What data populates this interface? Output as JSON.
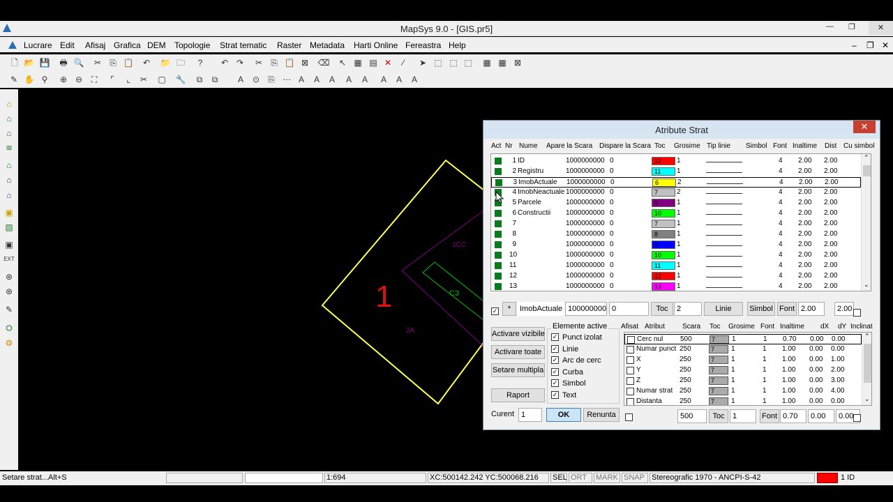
{
  "app": {
    "title": "MapSys 9.0 - [GIS.pr5]",
    "min": "—",
    "restore": "❐",
    "close": "✕"
  },
  "menu": [
    "Lucrare",
    "Edit",
    "Afisaj",
    "Grafica",
    "DEM",
    "Topologie",
    "Strat tematic",
    "Raster",
    "Metadata",
    "Harti Online",
    "Fereastra",
    "Help"
  ],
  "canvas": {
    "label_big": "1",
    "label_1cc": "1CC",
    "label_c3": "C3",
    "label_2a": "2A"
  },
  "status": {
    "hint": "Setare strat...Alt+S",
    "scale": "1:694",
    "coords": "XC:500142.242 YC:500068.216",
    "sel": "SEL",
    "ort": "ORT",
    "mark": "MARK",
    "snap": "SNAP",
    "proj": "Stereografic 1970 - ANCPI-S-42",
    "layer": "1 ID",
    "layer_color": "#ff0000"
  },
  "dialog": {
    "title": "Atribute Strat",
    "headers": {
      "act": "Act",
      "nr": "Nr",
      "nume": "Nume",
      "apare": "Apare la Scara",
      "dispare": "Dispare la Scara",
      "toc": "Toc",
      "grosime": "Grosime",
      "tip": "Tip linie",
      "simbol": "Simbol",
      "font": "Font",
      "inaltime": "Inaltime",
      "dist": "Dist",
      "cusimbol": "Cu simbol"
    },
    "rows": [
      {
        "nr": "1",
        "nume": "ID",
        "apare": "1000000000",
        "dispare": "0",
        "toc": "12",
        "color": "#ff0000",
        "gros": "1",
        "font": "4",
        "inalt": "2.00",
        "dist": "2.00"
      },
      {
        "nr": "2",
        "nume": "Registru",
        "apare": "1000000000",
        "dispare": "0",
        "toc": "11",
        "color": "#00ffff",
        "gros": "1",
        "font": "4",
        "inalt": "2.00",
        "dist": "2.00"
      },
      {
        "nr": "3",
        "nume": "ImobActuale",
        "apare": "1000000000",
        "dispare": "0",
        "toc": "6",
        "color": "#ffff00",
        "gros": "2",
        "font": "4",
        "inalt": "2.00",
        "dist": "2.00"
      },
      {
        "nr": "4",
        "nume": "ImobNeactuale",
        "apare": "1000000000",
        "dispare": "0",
        "toc": "7",
        "color": "#c0c0c0",
        "gros": "2",
        "font": "4",
        "inalt": "2.00",
        "dist": "2.00"
      },
      {
        "nr": "5",
        "nume": "Parcele",
        "apare": "1000000000",
        "dispare": "0",
        "toc": "5",
        "color": "#800080",
        "gros": "1",
        "font": "4",
        "inalt": "2.00",
        "dist": "2.00"
      },
      {
        "nr": "6",
        "nume": "Constructii",
        "apare": "1000000000",
        "dispare": "0",
        "toc": "10",
        "color": "#00ff00",
        "gros": "1",
        "font": "4",
        "inalt": "2.00",
        "dist": "2.00"
      },
      {
        "nr": "7",
        "nume": "",
        "apare": "1000000000",
        "dispare": "0",
        "toc": "7",
        "color": "#c0c0c0",
        "gros": "1",
        "font": "4",
        "inalt": "2.00",
        "dist": "2.00"
      },
      {
        "nr": "8",
        "nume": "",
        "apare": "1000000000",
        "dispare": "0",
        "toc": "8",
        "color": "#808080",
        "gros": "1",
        "font": "4",
        "inalt": "2.00",
        "dist": "2.00"
      },
      {
        "nr": "9",
        "nume": "",
        "apare": "1000000000",
        "dispare": "0",
        "toc": "9",
        "color": "#0000ff",
        "gros": "1",
        "font": "4",
        "inalt": "2.00",
        "dist": "2.00"
      },
      {
        "nr": "10",
        "nume": "",
        "apare": "1000000000",
        "dispare": "0",
        "toc": "10",
        "color": "#00ff00",
        "gros": "1",
        "font": "4",
        "inalt": "2.00",
        "dist": "2.00"
      },
      {
        "nr": "11",
        "nume": "",
        "apare": "1000000000",
        "dispare": "0",
        "toc": "11",
        "color": "#00ffff",
        "gros": "1",
        "font": "4",
        "inalt": "2.00",
        "dist": "2.00"
      },
      {
        "nr": "12",
        "nume": "",
        "apare": "1000000000",
        "dispare": "0",
        "toc": "12",
        "color": "#ff0000",
        "gros": "1",
        "font": "4",
        "inalt": "2.00",
        "dist": "2.00"
      },
      {
        "nr": "13",
        "nume": "",
        "apare": "1000000000",
        "dispare": "0",
        "toc": "13",
        "color": "#ff00ff",
        "gros": "1",
        "font": "4",
        "inalt": "2.00",
        "dist": "2.00"
      }
    ],
    "edit": {
      "star": "*",
      "nume": "ImobActuale",
      "apare": "1000000000",
      "dispare": "0",
      "toc_btn": "Toc",
      "toc_val": "2",
      "linie_btn": "Linie",
      "simbol_btn": "Simbol",
      "font_btn": "Font",
      "inalt": "2.00",
      "dist": "2.00"
    },
    "buttons": {
      "activare_vizibile": "Activare vizibile",
      "activare_toate": "Activare toate",
      "setare_multipla": "Setare multipla",
      "raport": "Raport",
      "ok": "OK",
      "renunta": "Renunta"
    },
    "elemente": {
      "title": "Elemente active",
      "items": [
        "Punct izolat",
        "Linie",
        "Arc de cerc",
        "Curba",
        "Simbol",
        "Text"
      ]
    },
    "curent": {
      "label": "Curent",
      "value": "1"
    },
    "attr_headers": {
      "afisat": "Afisat",
      "atribut": "Atribut",
      "scara": "Scara",
      "toc": "Toc",
      "grosime": "Grosime",
      "font": "Font",
      "inaltime": "Inaltime",
      "dx": "dX",
      "dy": "dY",
      "inclinat": "Inclinat"
    },
    "attrs": [
      {
        "name": "Cerc nul",
        "scara": "500",
        "toc": "7",
        "gros": "1",
        "font": "1",
        "inalt": "0.70",
        "dx": "0.00",
        "dy": "0.00"
      },
      {
        "name": "Numar punct",
        "scara": "250",
        "toc": "7",
        "gros": "1",
        "font": "1",
        "inalt": "1.00",
        "dx": "0.00",
        "dy": "0.00"
      },
      {
        "name": "X",
        "scara": "250",
        "toc": "7",
        "gros": "1",
        "font": "1",
        "inalt": "1.00",
        "dx": "0.00",
        "dy": "1.00"
      },
      {
        "name": "Y",
        "scara": "250",
        "toc": "7",
        "gros": "1",
        "font": "1",
        "inalt": "1.00",
        "dx": "0.00",
        "dy": "2.00"
      },
      {
        "name": "Z",
        "scara": "250",
        "toc": "7",
        "gros": "1",
        "font": "1",
        "inalt": "1.00",
        "dx": "0.00",
        "dy": "3.00"
      },
      {
        "name": "Numar strat",
        "scara": "250",
        "toc": "7",
        "gros": "1",
        "font": "1",
        "inalt": "1.00",
        "dx": "0.00",
        "dy": "4.00"
      },
      {
        "name": "Distanta",
        "scara": "250",
        "toc": "7",
        "gros": "1",
        "font": "1",
        "inalt": "1.00",
        "dx": "0.00",
        "dy": "0.00"
      }
    ],
    "attr_edit": {
      "scara": "500",
      "toc_btn": "Toc",
      "toc_val": "1",
      "font_btn": "Font",
      "inalt": "0.70",
      "dx": "0.00",
      "dy": "0.00"
    }
  }
}
